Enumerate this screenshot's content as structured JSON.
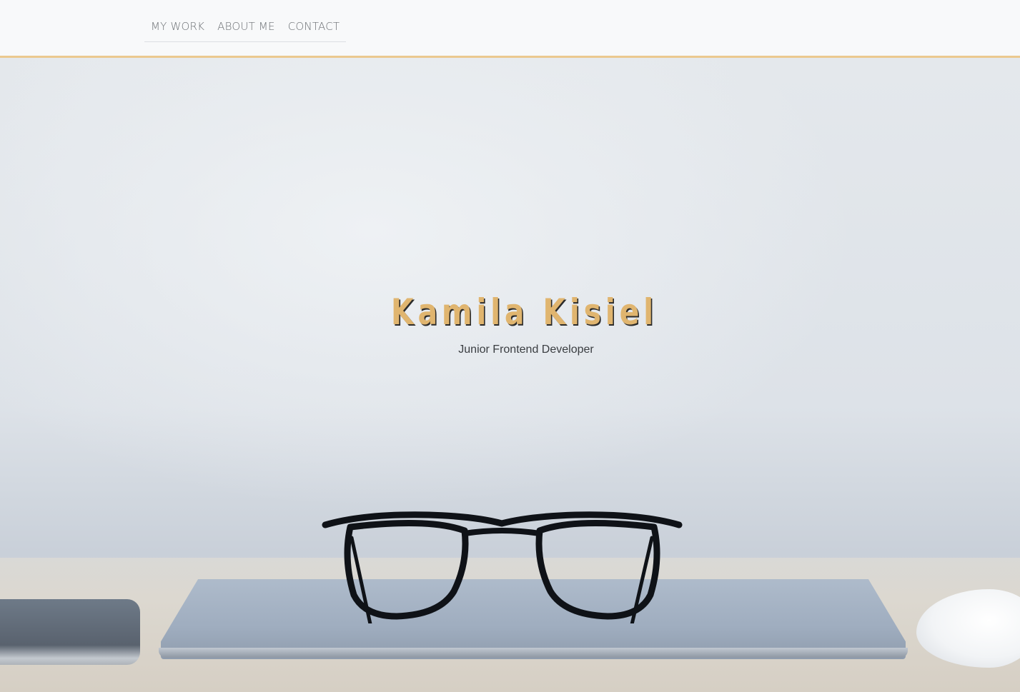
{
  "nav": {
    "items": [
      {
        "label": "MY WORK"
      },
      {
        "label": "ABOUT ME"
      },
      {
        "label": "CONTACT"
      }
    ]
  },
  "hero": {
    "name": "Kamila Kisiel",
    "subtitle": "Junior Frontend Developer"
  },
  "colors": {
    "accent": "#ebc98f",
    "name_text": "#e0b56f",
    "nav_text": "#6b6f73"
  }
}
